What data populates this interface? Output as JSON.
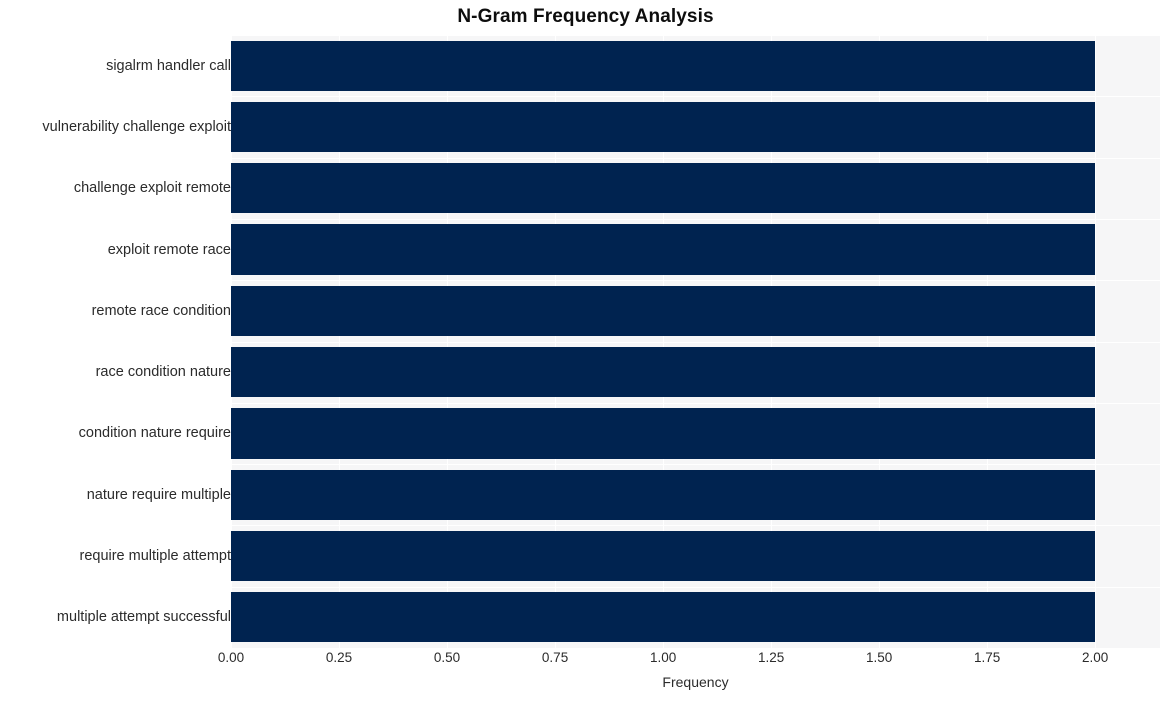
{
  "chart_data": {
    "type": "bar",
    "orientation": "horizontal",
    "title": "N-Gram Frequency Analysis",
    "xlabel": "Frequency",
    "ylabel": "",
    "categories": [
      "sigalrm handler call",
      "vulnerability challenge exploit",
      "challenge exploit remote",
      "exploit remote race",
      "remote race condition",
      "race condition nature",
      "condition nature require",
      "nature require multiple",
      "require multiple attempt",
      "multiple attempt successful"
    ],
    "values": [
      2,
      2,
      2,
      2,
      2,
      2,
      2,
      2,
      2,
      2
    ],
    "xlim": [
      0,
      2.15
    ],
    "xticks": [
      "0.00",
      "0.25",
      "0.50",
      "0.75",
      "1.00",
      "1.25",
      "1.50",
      "1.75",
      "2.00"
    ],
    "xtick_values": [
      0,
      0.25,
      0.5,
      0.75,
      1.0,
      1.25,
      1.5,
      1.75,
      2.0
    ],
    "grid": true,
    "legend": null,
    "bar_color": "#002350",
    "plot_background": "#f6f6f7",
    "grid_color": "#ffffff",
    "figure_background": "#ffffff",
    "text_color": "#2b2b2b",
    "title_color": "#0d0d0d"
  }
}
